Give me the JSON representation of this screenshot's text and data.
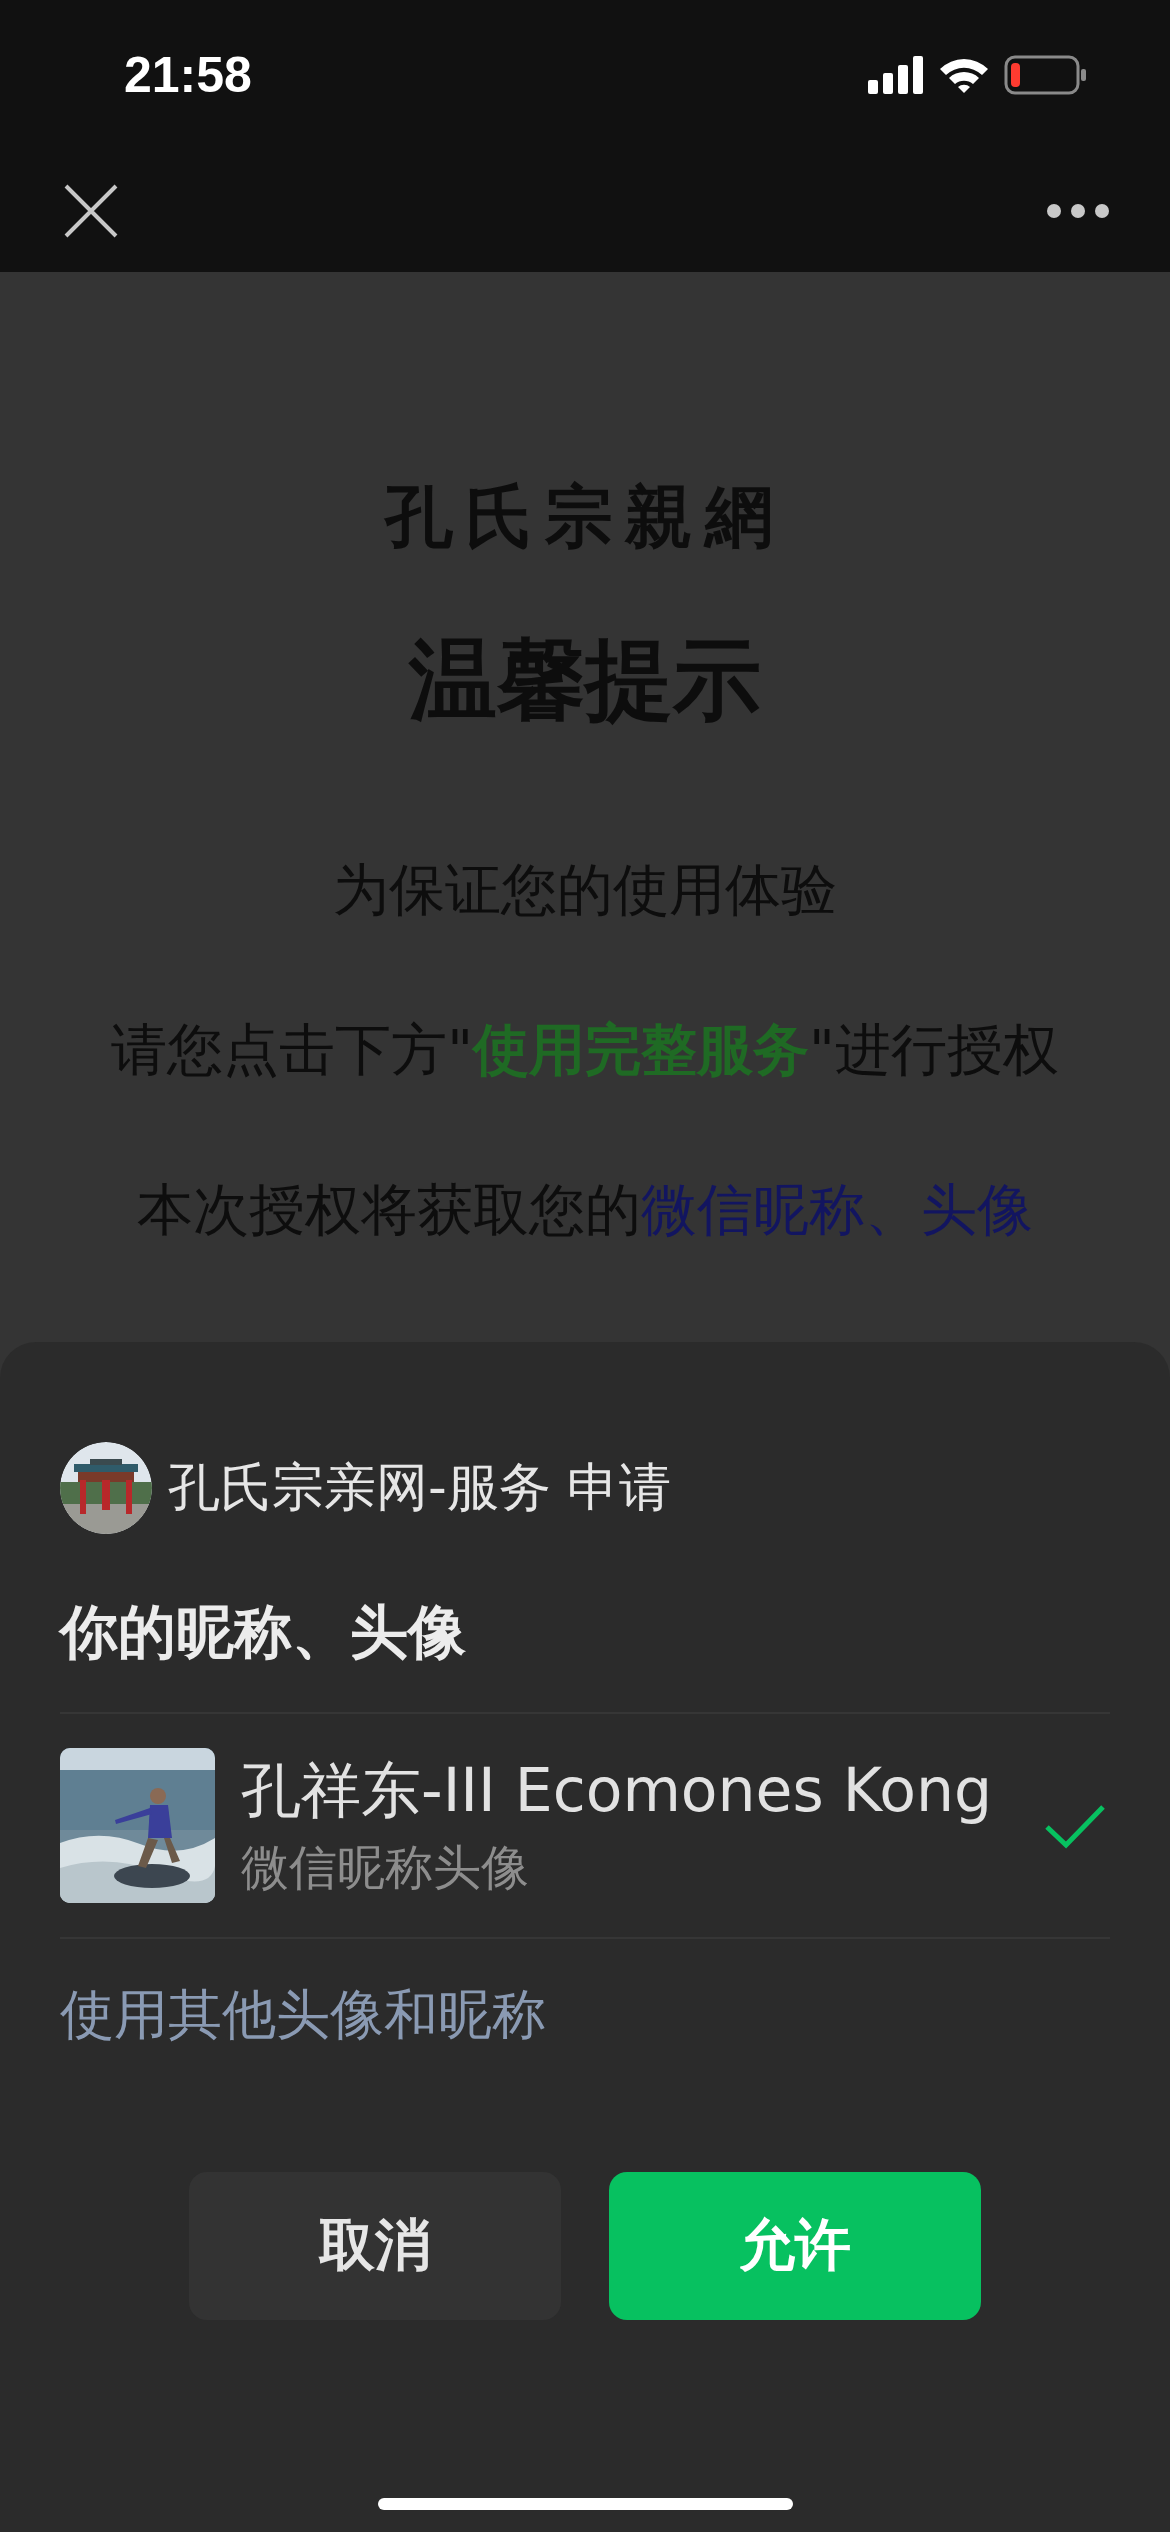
{
  "status_bar": {
    "time": "21:58"
  },
  "page": {
    "logo": "孔氏宗親網",
    "heading": "温馨提示",
    "lines": [
      [
        {
          "kind": "plain",
          "text": "为保证您的使用体验"
        }
      ],
      [
        {
          "kind": "plain",
          "text": "请您点击下方\""
        },
        {
          "kind": "service",
          "text": "使用完整服务"
        },
        {
          "kind": "plain",
          "text": "\"进行授权"
        }
      ],
      [
        {
          "kind": "plain",
          "text": "本次授权将获取您的"
        },
        {
          "kind": "info",
          "text": "微信昵称、头像"
        }
      ]
    ]
  },
  "sheet": {
    "app_name": "孔氏宗亲网-服务",
    "request_label": "申请",
    "title": "你的昵称、头像",
    "profiles": [
      {
        "name": "孔祥东-III Ecomones Kong",
        "subtitle": "微信昵称头像",
        "selected": true
      }
    ],
    "other_link": "使用其他头像和昵称",
    "buttons": [
      {
        "kind": "cancel",
        "label": "取消"
      },
      {
        "kind": "allow",
        "label": "允许"
      }
    ]
  }
}
